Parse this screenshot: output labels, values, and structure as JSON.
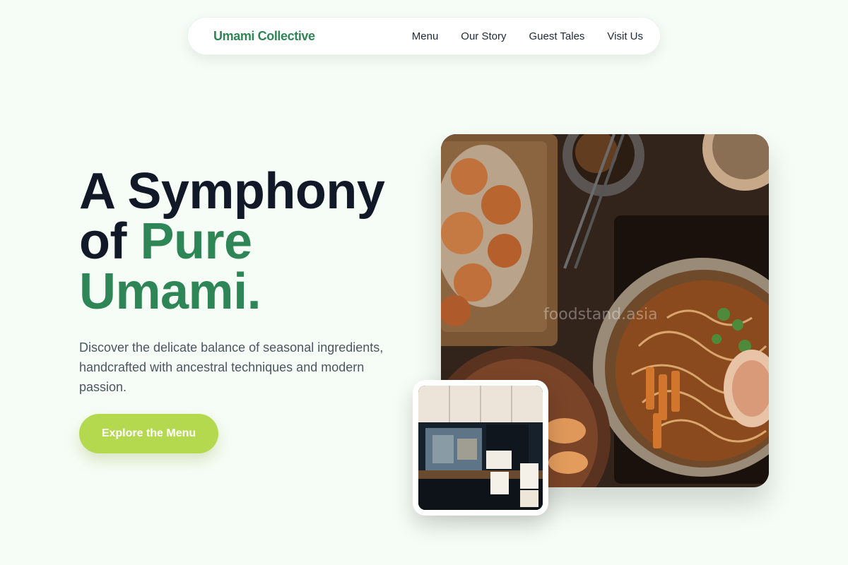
{
  "nav": {
    "brand": "Umami Collective",
    "links": [
      "Menu",
      "Our Story",
      "Guest Tales",
      "Visit Us"
    ]
  },
  "hero": {
    "title_line1": "A Symphony",
    "title_of": "of",
    "title_accent1": "Pure",
    "title_accent2": "Umami.",
    "subtitle": "Discover the delicate balance of seasonal ingredients, handcrafted with ancestral techniques and modern passion.",
    "cta": "Explore the Menu",
    "image_watermark": "foodstand.asia"
  },
  "colors": {
    "background": "#f6fdf6",
    "brand_green": "#2e8555",
    "cta_lime": "#b5d94e",
    "heading": "#111827"
  }
}
